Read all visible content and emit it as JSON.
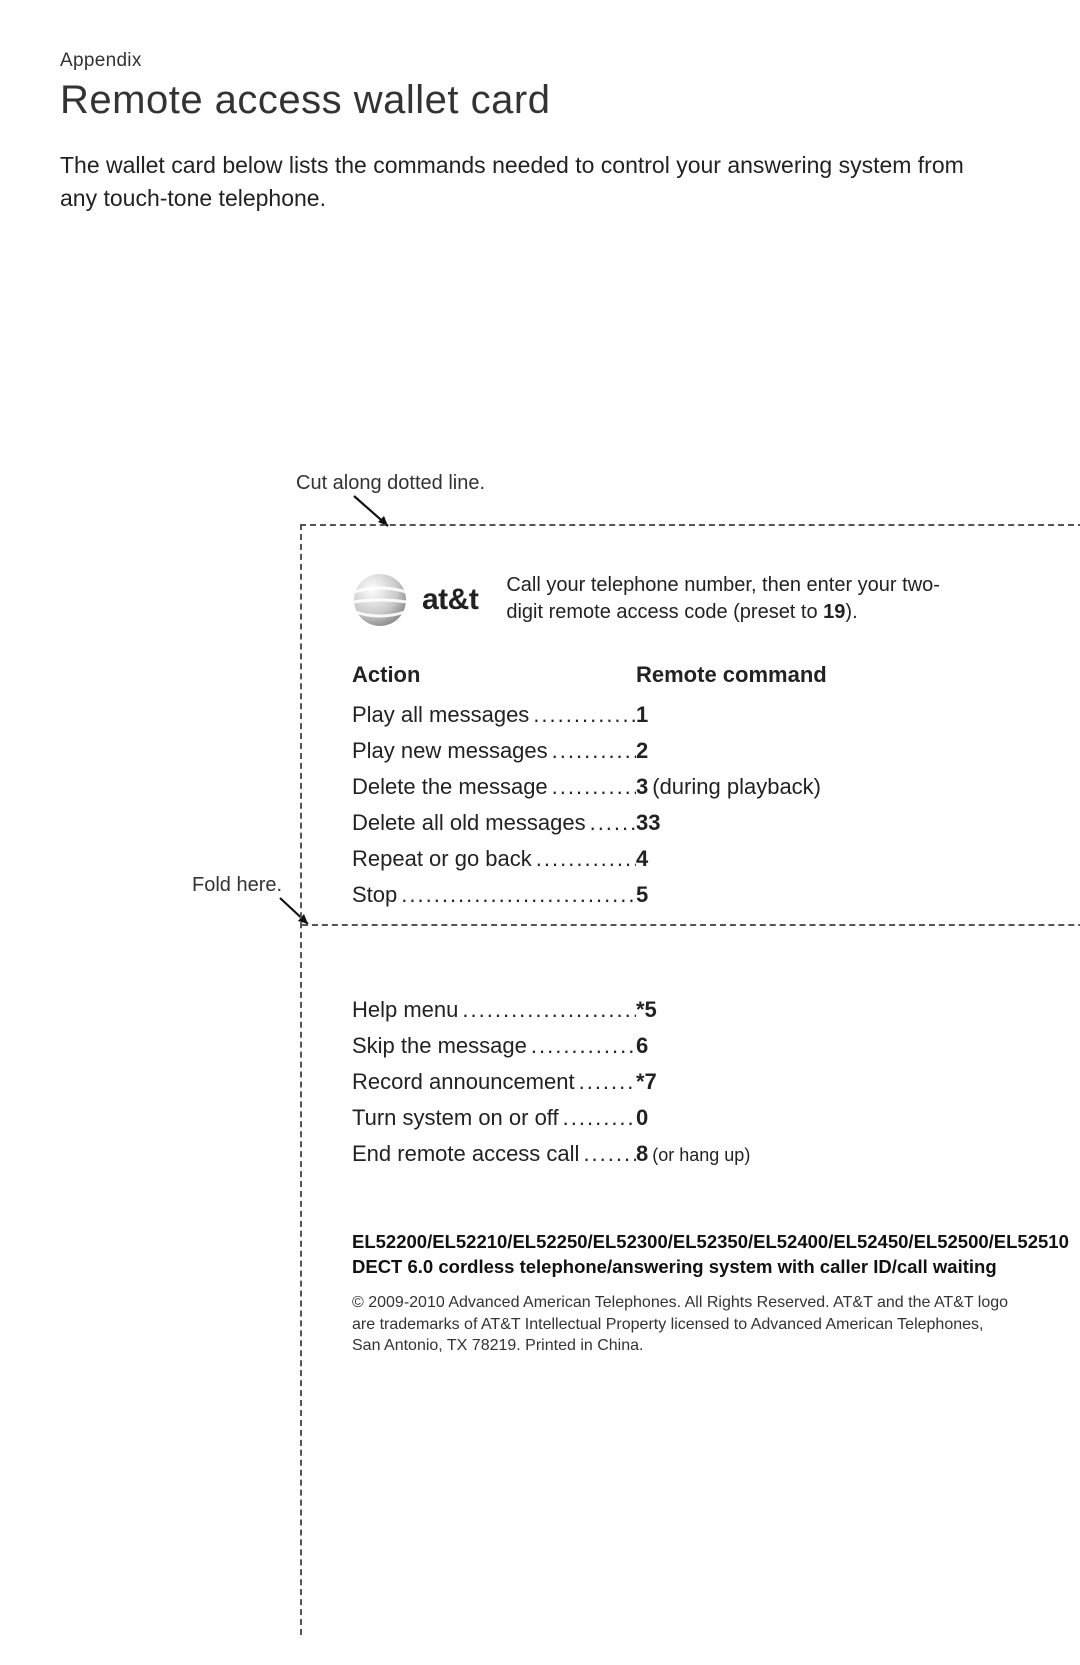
{
  "section": "Appendix",
  "title": "Remote access wallet card",
  "intro": "The wallet card below lists the commands needed to control your answering system from any touch-tone telephone.",
  "cut_label": "Cut along dotted line.",
  "fold_label": "Fold here.",
  "logo_text": "at&t",
  "instruction_pre": "Call your telephone number, then enter your two-digit remote access code (preset to ",
  "instruction_code": "19",
  "instruction_post": ").",
  "headers": {
    "action": "Action",
    "command": "Remote command"
  },
  "commands_top": [
    {
      "action": "Play all messages",
      "code": "1",
      "note": ""
    },
    {
      "action": "Play new messages",
      "code": "2",
      "note": ""
    },
    {
      "action": "Delete the message",
      "code": "3",
      "note": "(during playback)"
    },
    {
      "action": "Delete all old messages",
      "code": "33",
      "note": ""
    },
    {
      "action": "Repeat or go back",
      "code": "4",
      "note": ""
    },
    {
      "action": "Stop",
      "code": "5",
      "note": ""
    }
  ],
  "commands_bottom": [
    {
      "action": "Help menu",
      "code": "*5",
      "note": ""
    },
    {
      "action": "Skip the message",
      "code": "6",
      "note": ""
    },
    {
      "action": "Record announcement",
      "code": "*7",
      "note": ""
    },
    {
      "action": "Turn system on or off",
      "code": "0",
      "note": ""
    },
    {
      "action": "End remote access call",
      "code": "8",
      "note": "(or hang up)",
      "small": true
    }
  ],
  "models": "EL52200/EL52210/EL52250/EL52300/EL52350/EL52400/EL52450/EL52500/EL52510 DECT 6.0 cordless telephone/answering system with caller ID/call waiting",
  "copyright": "© 2009-2010 Advanced American Telephones. All Rights Reserved. AT&T and the AT&T logo are trademarks of AT&T Intellectual Property licensed to Advanced American Telephones, San Antonio, TX 78219. Printed in China."
}
